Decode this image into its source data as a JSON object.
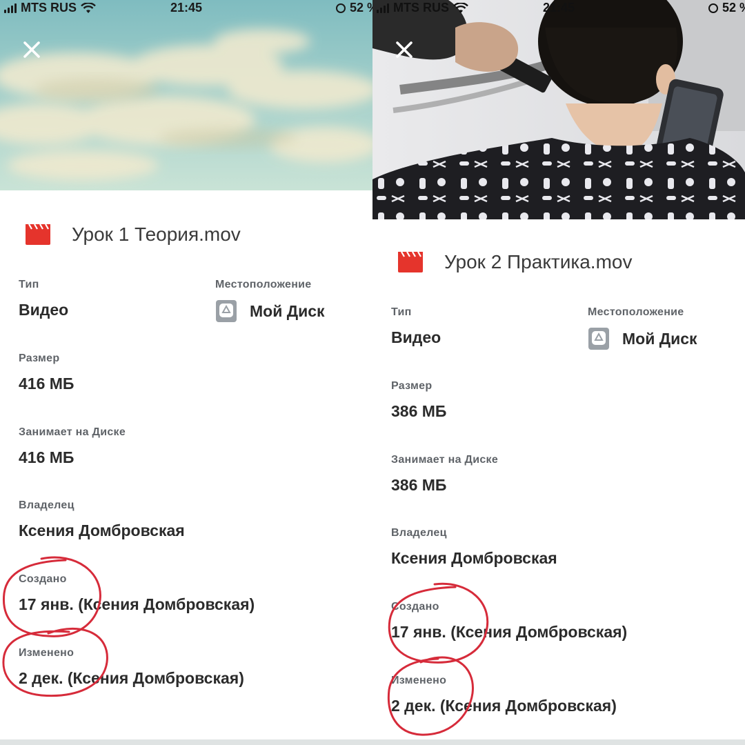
{
  "status_bar": {
    "carrier": "MTS RUS",
    "time": "21:45",
    "battery": "52 %"
  },
  "panels": [
    {
      "file_name": "Урок 1 Теория.mov",
      "type_label": "Тип",
      "type_value": "Видео",
      "location_label": "Местоположение",
      "location_value": "Мой Диск",
      "size_label": "Размер",
      "size_value": "416 МБ",
      "disk_label": "Занимает на Диске",
      "disk_value": "416 МБ",
      "owner_label": "Владелец",
      "owner_value": "Ксения Домбровская",
      "created_label": "Создано",
      "created_value": "17 янв. (Ксения Домбровская)",
      "modified_label": "Изменено",
      "modified_value": "2 дек. (Ксения Домбровская)"
    },
    {
      "file_name": "Урок 2 Практика.mov",
      "type_label": "Тип",
      "type_value": "Видео",
      "location_label": "Местоположение",
      "location_value": "Мой Диск",
      "size_label": "Размер",
      "size_value": "386 МБ",
      "disk_label": "Занимает на Диске",
      "disk_value": "386 МБ",
      "owner_label": "Владелец",
      "owner_value": "Ксения Домбровская",
      "created_label": "Создано",
      "created_value": "17 янв. (Ксения Домбровская)",
      "modified_label": "Изменено",
      "modified_value": "2 дек. (Ксения Домбровская)"
    }
  ],
  "icons": {
    "close": "close-icon",
    "file": "video-file-icon",
    "location": "drive-icon",
    "signal": "signal-icon",
    "wifi": "wifi-icon"
  },
  "colors": {
    "file_icon": "#e5342c",
    "annotation": "#d62b3a",
    "label": "#5f6368",
    "value": "#2b2b2b"
  }
}
